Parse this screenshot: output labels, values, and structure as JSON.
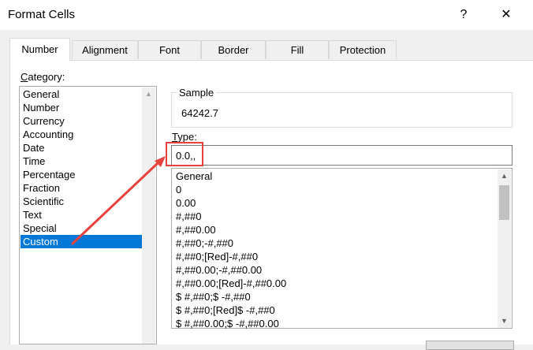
{
  "window": {
    "title": "Format Cells",
    "help": "?",
    "close": "✕"
  },
  "tabs": [
    {
      "label": "Number",
      "active": true
    },
    {
      "label": "Alignment"
    },
    {
      "label": "Font"
    },
    {
      "label": "Border"
    },
    {
      "label": "Fill"
    },
    {
      "label": "Protection"
    }
  ],
  "category": {
    "label_accel": "C",
    "label_rest": "ategory:",
    "items": [
      "General",
      "Number",
      "Currency",
      "Accounting",
      "Date",
      "Time",
      "Percentage",
      "Fraction",
      "Scientific",
      "Text",
      "Special",
      "Custom"
    ],
    "selected": "Custom"
  },
  "sample": {
    "label": "Sample",
    "value": "64242.7"
  },
  "type": {
    "label_accel": "T",
    "label_rest": "ype:",
    "value": "0.0,,"
  },
  "formats": [
    "General",
    "0",
    "0.00",
    "#,##0",
    "#,##0.00",
    "#,##0;-#,##0",
    "#,##0;[Red]-#,##0",
    "#,##0.00;-#,##0.00",
    "#,##0.00;[Red]-#,##0.00",
    "$ #,##0;$ -#,##0",
    "$ #,##0;[Red]$ -#,##0",
    "$ #,##0.00;$ -#,##0.00"
  ],
  "colors": {
    "selection": "#0078d7",
    "annotation": "#e8423f"
  },
  "icons": {
    "scroll_up": "chevron-up-icon",
    "scroll_down": "chevron-down-icon"
  }
}
